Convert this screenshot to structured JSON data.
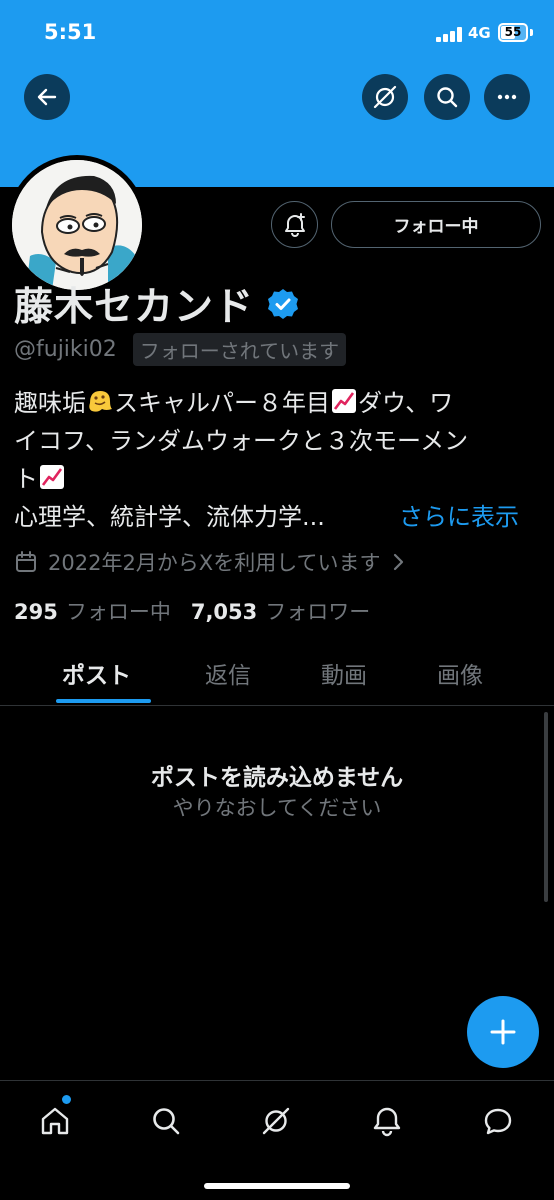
{
  "status_bar": {
    "time": "5:51",
    "network": "4G",
    "battery": "55"
  },
  "header": {
    "back_icon": "arrow-left-icon",
    "grok_icon": "slash-circle-icon",
    "search_icon": "search-icon",
    "more_icon": "more-dots-icon",
    "banner_color": "#1d9bf0"
  },
  "profile": {
    "display_name": "藤木セカンド",
    "handle": "@fujiki02",
    "follows_you": "フォローされています",
    "follow_button": "フォロー中",
    "bio_lines": [
      "趣味垢",
      "スキャルパー８年目",
      "ダウ、ワ",
      "イコフ、ランダムウォークと３次モーメン",
      "ト",
      "心理学、統計学、流体力学...",
      "さらに表示"
    ],
    "joined": "2022年2月からXを利用しています",
    "following_count": "295",
    "following_label": "フォロー中",
    "followers_count": "7,053",
    "followers_label": "フォロワー"
  },
  "tabs": [
    {
      "label": "ポスト",
      "active": true
    },
    {
      "label": "返信",
      "active": false
    },
    {
      "label": "動画",
      "active": false
    },
    {
      "label": "画像",
      "active": false
    }
  ],
  "empty_state": {
    "title": "ポストを読み込めません",
    "subtitle": "やりなおしてください"
  },
  "bottom_nav": [
    "home-icon",
    "search-icon",
    "grok-icon",
    "notifications-icon",
    "messages-icon"
  ],
  "colors": {
    "accent": "#1d9bf0",
    "background": "#000000",
    "muted": "#71767b"
  }
}
